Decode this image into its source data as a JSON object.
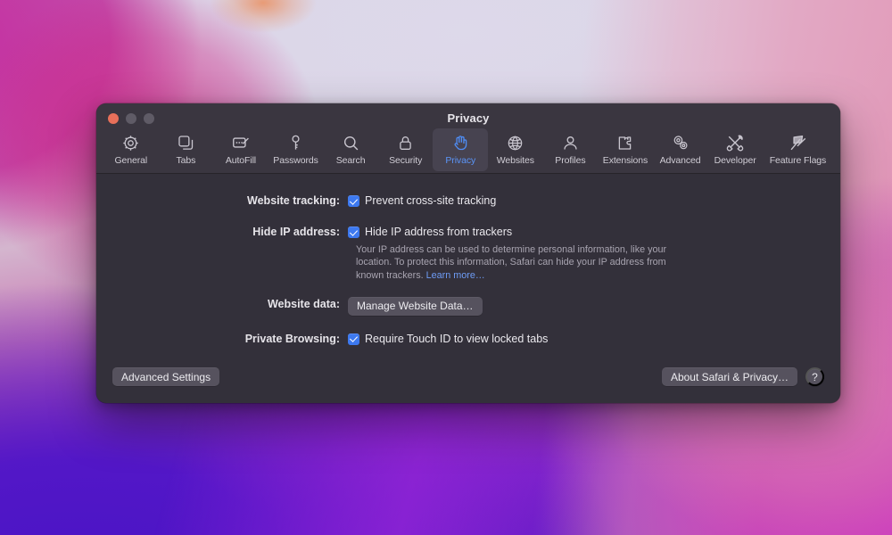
{
  "window": {
    "title": "Privacy",
    "traffic_lights": [
      {
        "name": "close",
        "color": "#e8705a"
      },
      {
        "name": "minimize",
        "color": "#5f5b66"
      },
      {
        "name": "zoom",
        "color": "#5f5b66"
      }
    ]
  },
  "toolbar": {
    "selected": "Privacy",
    "accent_color": "#5b94f7",
    "tabs": [
      {
        "label": "General",
        "icon": "gear-icon"
      },
      {
        "label": "Tabs",
        "icon": "tabs-icon"
      },
      {
        "label": "AutoFill",
        "icon": "autofill-card-pencil-icon"
      },
      {
        "label": "Passwords",
        "icon": "key-icon"
      },
      {
        "label": "Search",
        "icon": "magnifier-icon"
      },
      {
        "label": "Security",
        "icon": "lock-icon"
      },
      {
        "label": "Privacy",
        "icon": "raised-hand-icon"
      },
      {
        "label": "Websites",
        "icon": "globe-icon"
      },
      {
        "label": "Profiles",
        "icon": "person-icon"
      },
      {
        "label": "Extensions",
        "icon": "puzzle-piece-icon"
      },
      {
        "label": "Advanced",
        "icon": "gears-icon"
      },
      {
        "label": "Developer",
        "icon": "hammer-wrench-icon"
      },
      {
        "label": "Feature Flags",
        "icon": "flags-icon"
      }
    ]
  },
  "settings": {
    "website_tracking": {
      "label": "Website tracking:",
      "checkbox_label": "Prevent cross-site tracking",
      "checked": true
    },
    "hide_ip": {
      "label": "Hide IP address:",
      "checkbox_label": "Hide IP address from trackers",
      "checked": true,
      "help_text": "Your IP address can be used to determine personal information, like your location. To protect this information, Safari can hide your IP address from known trackers. ",
      "help_link": "Learn more…"
    },
    "website_data": {
      "label": "Website data:",
      "button_label": "Manage Website Data…"
    },
    "private_browsing": {
      "label": "Private Browsing:",
      "checkbox_label": "Require Touch ID to view locked tabs",
      "checked": true
    }
  },
  "footer": {
    "advanced_settings_label": "Advanced Settings",
    "about_label": "About Safari & Privacy…",
    "help_label": "?"
  }
}
